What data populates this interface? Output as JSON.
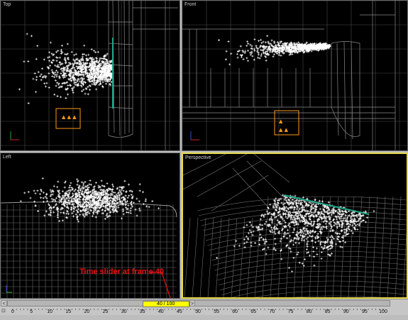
{
  "viewports": {
    "top": {
      "label": "Top"
    },
    "front": {
      "label": "Front"
    },
    "left": {
      "label": "Left"
    },
    "perspective": {
      "label": "Perspective",
      "active": true
    }
  },
  "annotation": {
    "text": "Time slider at frame 40"
  },
  "time_slider": {
    "current_frame": 40,
    "total_frames": 100,
    "display": "40 / 100",
    "prev_arrow": "<",
    "next_arrow": ">",
    "ticks": [
      "0",
      "5",
      "10",
      "15",
      "20",
      "25",
      "30",
      "35",
      "40",
      "45",
      "50",
      "55",
      "60",
      "65",
      "70",
      "75",
      "80",
      "85",
      "90",
      "95",
      "100"
    ]
  },
  "colors": {
    "viewport_bg": "#000000",
    "grid": "#5a5a5a",
    "particles": "#ffffff",
    "emitter": "#ff9a1a",
    "active_border": "#e6d94a",
    "annotation": "#ee1111",
    "slider_thumb": "#ffff00"
  }
}
